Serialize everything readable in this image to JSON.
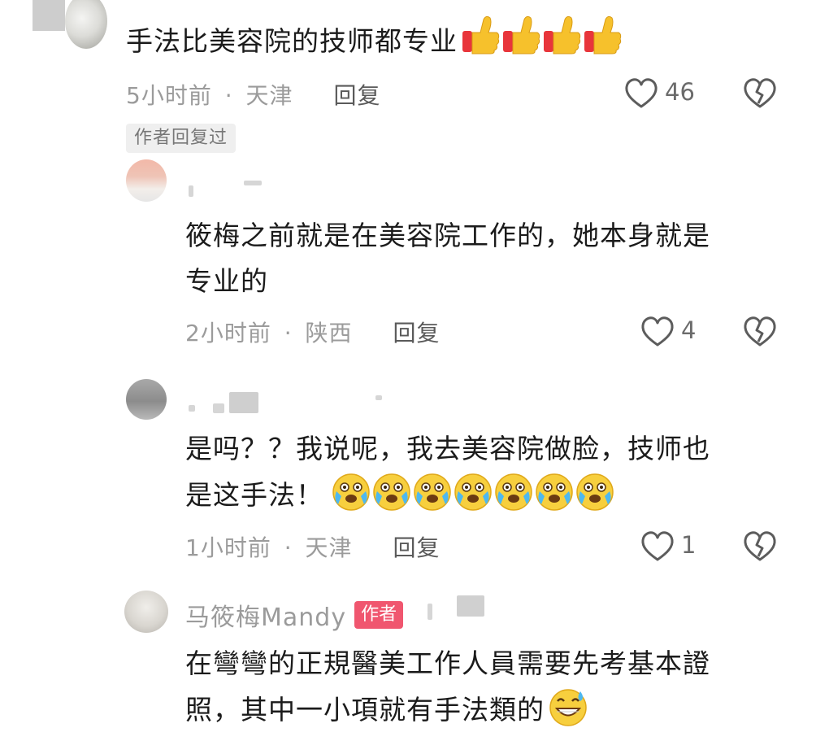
{
  "comment1": {
    "text": "手法比美容院的技师都专业",
    "time": "5小时前",
    "location": "天津",
    "reply_label": "回复",
    "likes": "46",
    "author_replied_tag": "作者回复过"
  },
  "reply1": {
    "text_line1": "筱梅之前就是在美容院工作的，她本身就是",
    "text_line2": "专业的",
    "time": "2小时前",
    "location": "陕西",
    "reply_label": "回复",
    "likes": "4"
  },
  "reply2": {
    "text_line1": "是吗？？我说呢，我去美容院做脸，技师也",
    "text_line2": "是这手法！",
    "time": "1小时前",
    "location": "天津",
    "reply_label": "回复",
    "likes": "1"
  },
  "reply3": {
    "author": "马筱梅Mandy",
    "author_tag": "作者",
    "text_line1": "在彎彎的正規醫美工作人員需要先考基本證",
    "text_line2": "照，其中一小項就有手法類的"
  },
  "separator": "·",
  "icons": {
    "like": "heart-outline-icon",
    "dislike": "broken-heart-icon",
    "thumbs_up": "thumbs-up-emoji",
    "crying": "crying-emoji",
    "sweat_smile": "grinning-sweat-emoji"
  },
  "colors": {
    "author_tag": "#f0566f",
    "meta_text": "#9b9b9b",
    "main_text": "#1b1b1b"
  }
}
